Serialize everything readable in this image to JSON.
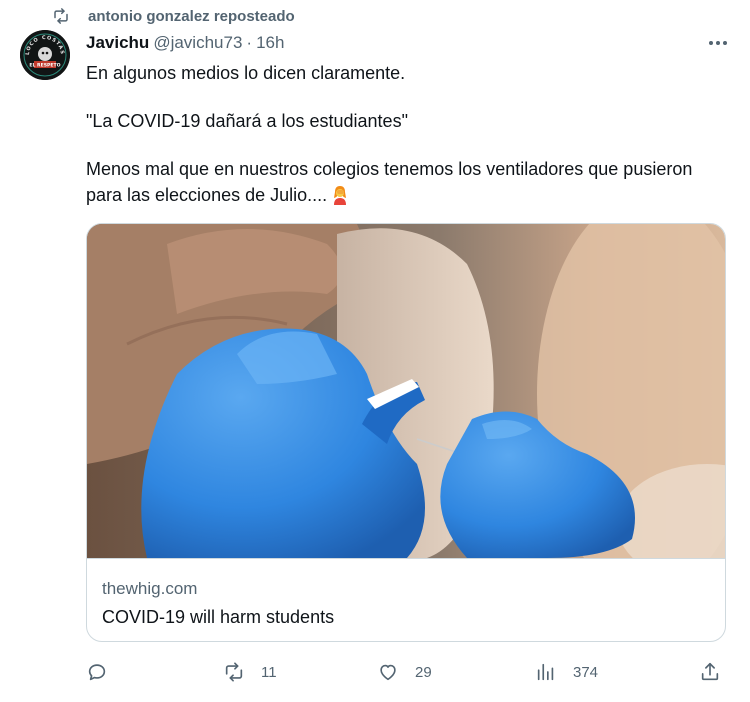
{
  "repost": {
    "text": "antonio gonzalez reposteado",
    "icon": "repost-icon"
  },
  "author": {
    "display_name": "Javichu",
    "handle": "@javichu73",
    "separator": "·",
    "time": "16h"
  },
  "avatar": {
    "ring_text": "LOCO COSTAS",
    "badge_text": "EL RESPETO"
  },
  "tweet": {
    "lines": [
      "En algunos medios lo dicen claramente.",
      "\"La COVID-19 dañará a los estudiantes\"",
      "Menos mal que en nuestros colegios tenemos los ventiladores que pusieron para las elecciones de Julio...."
    ],
    "emoji": "woman-facepalming-emoji"
  },
  "card": {
    "domain": "thewhig.com",
    "title": "COVID-19 will harm students",
    "image": "gloved-hands-giving-vaccine-injection-photo"
  },
  "actions": {
    "reply": {
      "count": "",
      "icon": "reply-icon"
    },
    "retweet": {
      "count": "11",
      "icon": "retweet-icon"
    },
    "like": {
      "count": "29",
      "icon": "heart-icon"
    },
    "views": {
      "count": "374",
      "icon": "views-icon"
    },
    "share": {
      "icon": "share-icon"
    }
  },
  "colors": {
    "text": "#0f1419",
    "secondary": "#536471",
    "border": "#cfd9de",
    "glove": "#2f86e0"
  }
}
